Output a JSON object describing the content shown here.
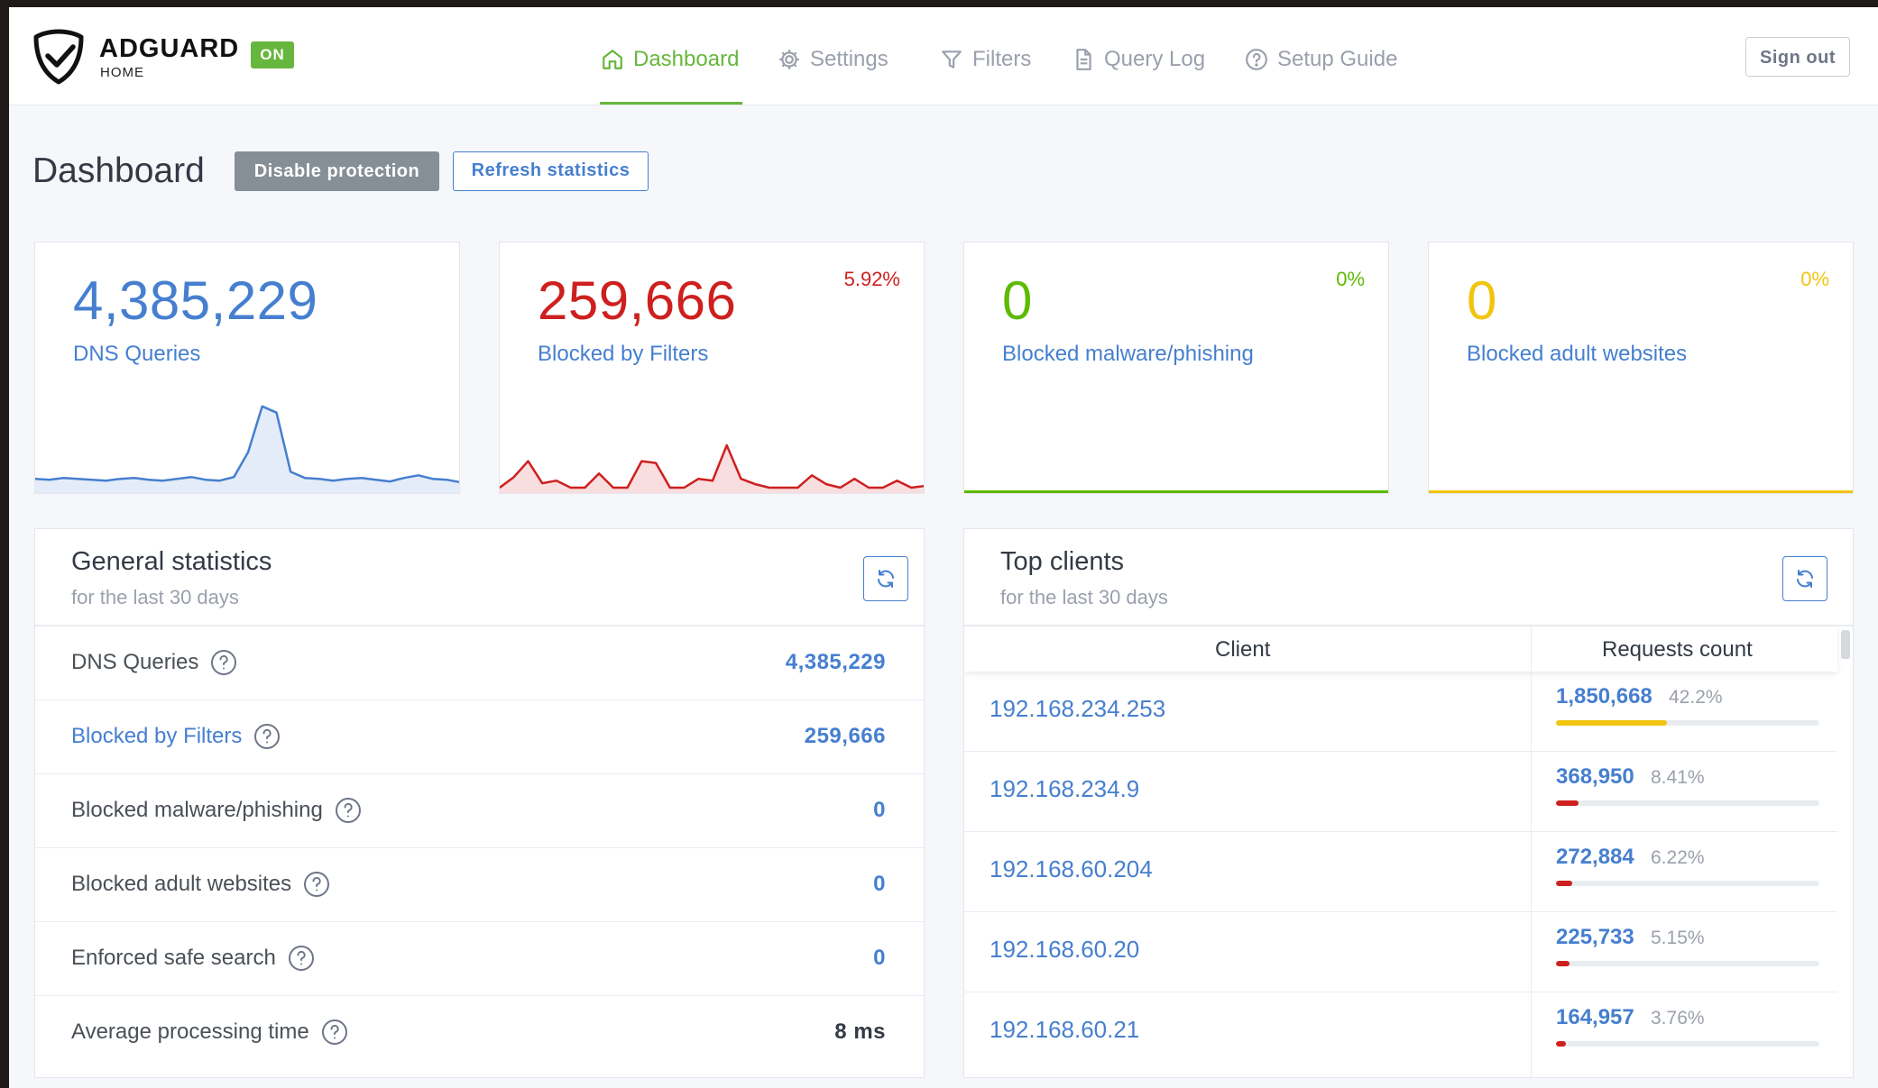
{
  "header": {
    "brand": "ADGUARD",
    "brand_sub": "HOME",
    "status_badge": "ON",
    "nav": [
      {
        "label": "Dashboard",
        "icon": "home-icon",
        "active": true
      },
      {
        "label": "Settings",
        "icon": "gear-icon",
        "active": false
      },
      {
        "label": "Filters",
        "icon": "filter-icon",
        "active": false
      },
      {
        "label": "Query Log",
        "icon": "document-icon",
        "active": false
      },
      {
        "label": "Setup Guide",
        "icon": "help-circle-icon",
        "active": false
      }
    ],
    "sign_out": "Sign out"
  },
  "page": {
    "title": "Dashboard",
    "disable_protection": "Disable protection",
    "refresh_statistics": "Refresh statistics"
  },
  "cards": [
    {
      "value": "4,385,229",
      "label": "DNS Queries",
      "percent": "",
      "color": "#467fcf",
      "sparkline": [
        10,
        9,
        11,
        10,
        9,
        8,
        10,
        11,
        9,
        8,
        10,
        12,
        9,
        8,
        12,
        40,
        92,
        85,
        18,
        11,
        10,
        8,
        10,
        11,
        9,
        7,
        11,
        14,
        10,
        9,
        6
      ]
    },
    {
      "value": "259,666",
      "label": "Blocked by Filters",
      "percent": "5.92%",
      "color": "#cd201f",
      "sparkline": [
        0,
        12,
        30,
        5,
        8,
        0,
        0,
        16,
        0,
        0,
        30,
        28,
        0,
        0,
        10,
        8,
        48,
        10,
        4,
        0,
        0,
        0,
        14,
        4,
        0,
        10,
        0,
        0,
        8,
        0,
        2
      ]
    },
    {
      "value": "0",
      "label": "Blocked malware/phishing",
      "percent": "0%",
      "color": "#5eba00"
    },
    {
      "value": "0",
      "label": "Blocked adult websites",
      "percent": "0%",
      "color": "#f1c40f"
    }
  ],
  "general_statistics": {
    "title": "General statistics",
    "subtitle": "for the last 30 days",
    "rows": [
      {
        "label": "DNS Queries",
        "value": "4,385,229"
      },
      {
        "label": "Blocked by Filters",
        "value": "259,666"
      },
      {
        "label": "Blocked malware/phishing",
        "value": "0"
      },
      {
        "label": "Blocked adult websites",
        "value": "0"
      },
      {
        "label": "Enforced safe search",
        "value": "0"
      },
      {
        "label": "Average processing time",
        "value": "8 ms"
      }
    ]
  },
  "top_clients": {
    "title": "Top clients",
    "subtitle": "for the last 30 days",
    "columns": [
      "Client",
      "Requests count"
    ],
    "rows": [
      {
        "ip": "192.168.234.253",
        "count": "1,850,668",
        "percent": "42.2%",
        "fraction": 0.422,
        "bar_color": "#f1c40f"
      },
      {
        "ip": "192.168.234.9",
        "count": "368,950",
        "percent": "8.41%",
        "fraction": 0.0841,
        "bar_color": "#cd201f"
      },
      {
        "ip": "192.168.60.204",
        "count": "272,884",
        "percent": "6.22%",
        "fraction": 0.0622,
        "bar_color": "#cd201f"
      },
      {
        "ip": "192.168.60.20",
        "count": "225,733",
        "percent": "5.15%",
        "fraction": 0.0515,
        "bar_color": "#cd201f"
      },
      {
        "ip": "192.168.60.21",
        "count": "164,957",
        "percent": "3.76%",
        "fraction": 0.0376,
        "bar_color": "#cd201f"
      }
    ]
  }
}
